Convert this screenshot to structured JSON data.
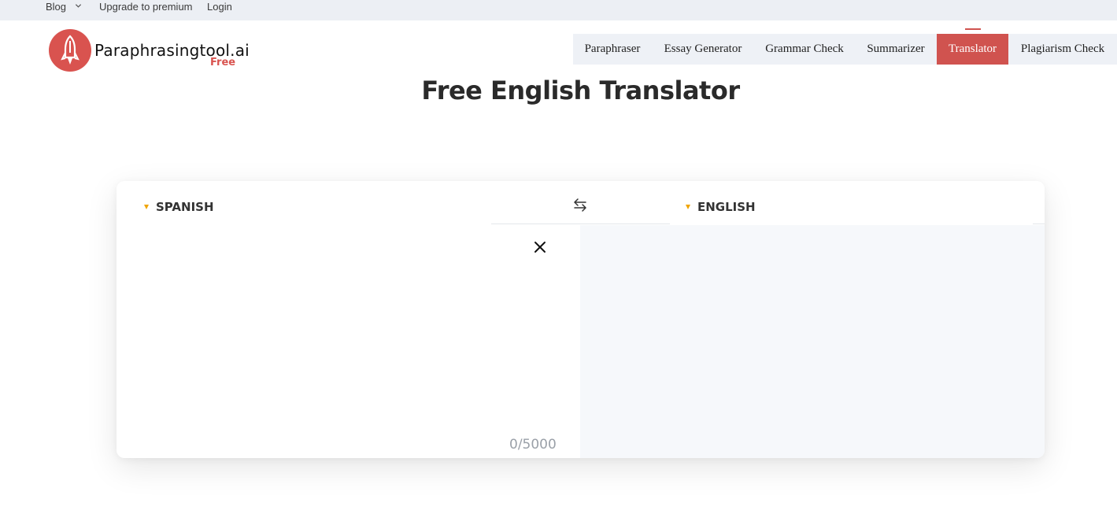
{
  "topbar": {
    "blog": "Blog",
    "upgrade": "Upgrade to premium",
    "login": "Login"
  },
  "logo": {
    "name": "Paraphrasingtool.ai",
    "badge": "Free"
  },
  "nav": {
    "items": [
      "Paraphraser",
      "Essay Generator",
      "Grammar Check",
      "Summarizer",
      "Translator",
      "Plagiarism Check"
    ],
    "active": "Translator"
  },
  "page": {
    "title": "Free English Translator"
  },
  "translator": {
    "source_lang": "SPANISH",
    "target_lang": "ENGLISH",
    "input_value": "",
    "counter": "0/5000"
  },
  "colors": {
    "brand": "#d0534f",
    "accent_triangle": "#f0a500",
    "topbar_bg": "#eceff4",
    "nav_bg": "#eef1f6",
    "output_bg": "#f6f8fb"
  },
  "icons": {
    "blog_dropdown": "chevron-down-icon",
    "logo": "rocket-logo-icon",
    "source_dropdown": "triangle-down-icon",
    "swap": "swap-arrows-icon",
    "clear": "close-icon",
    "target_dropdown": "triangle-down-icon"
  }
}
